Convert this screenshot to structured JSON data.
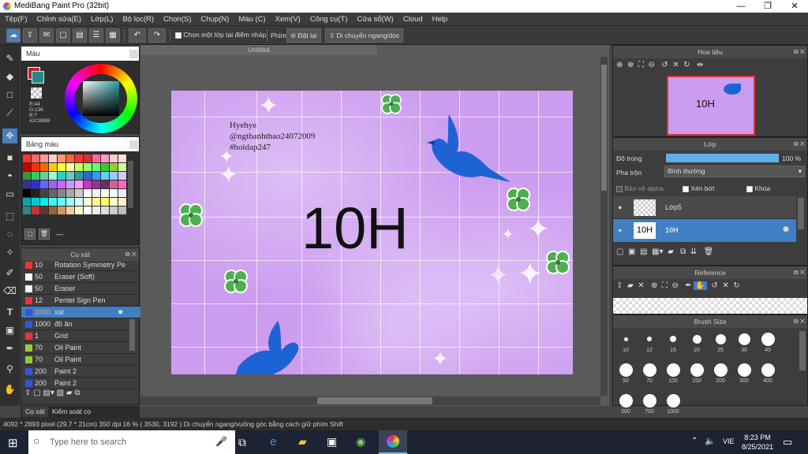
{
  "window": {
    "title": "MediBang Paint Pro (32bit)",
    "minimize_icon": "—",
    "restore_icon": "❐",
    "close_icon": "✕"
  },
  "menu": [
    "Tệp(F)",
    "Chỉnh sửa(E)",
    "Lớp(L)",
    "Bộ lọc(R)",
    "Chọn(S)",
    "Chụp(N)",
    "Màu (C)",
    "Xem(V)",
    "Công cụ(T)",
    "Cửa sổ(W)",
    "Cloud",
    "Help"
  ],
  "toolbar": {
    "sample_merged_label": "Chọn một lớp tại điểm nháp",
    "key_label": "Phím",
    "reset_label": "Đặt lại",
    "move_label": "Di chuyển ngang/dọc"
  },
  "color_panel": {
    "title": "Màu",
    "r": "R:44",
    "g": "G:136",
    "b": "B:?",
    "hex": "#2C8888"
  },
  "palette": {
    "title": "Bảng màu"
  },
  "document": {
    "tab_title": "Untitled"
  },
  "canvas": {
    "text_lines": [
      "Hyehye",
      "@ngthanhthao24072009",
      "#hoidap247"
    ],
    "big_text": "10H"
  },
  "navigator": {
    "title": "Hoa tiêu"
  },
  "layer_panel": {
    "title": "Lớp",
    "opacity_label": "Độ trong",
    "opacity_value": "100 %",
    "opacity_fraction": 1.0,
    "blend_label": "Pha trộn",
    "blend_value": "Bình thường",
    "protect_alpha": "Bảo vệ alpha",
    "clipping": "Xén bớt",
    "lock": "Khóa",
    "layers": [
      {
        "name": "Lớp5",
        "thumb": ""
      },
      {
        "name": "10H",
        "thumb": "10H"
      }
    ]
  },
  "reference": {
    "title": "Reference"
  },
  "brush_size": {
    "title": "Brush Size",
    "row1": [
      "10",
      "12",
      "15",
      "20",
      "25",
      "30",
      "40"
    ],
    "row2": [
      "50",
      "70",
      "100",
      "150",
      "200",
      "300",
      "400"
    ],
    "row3": [
      "500",
      "700",
      "1000"
    ]
  },
  "brush_panel": {
    "title": "Cọ xát",
    "brushes": [
      {
        "size": "10",
        "name": "Rotation Symmetry Pe",
        "color": "#e33"
      },
      {
        "size": "50",
        "name": "Eraser (Soft)",
        "color": "#fff"
      },
      {
        "size": "50",
        "name": "Eraser",
        "color": "#fff"
      },
      {
        "size": "12",
        "name": "Pentel  Sign Pen",
        "color": "#e33"
      },
      {
        "size": "1000",
        "name": "xát",
        "color": "#3355dd"
      },
      {
        "size": "1000",
        "name": "đồ ăn",
        "color": "#3355dd"
      },
      {
        "size": "1",
        "name": "Grid",
        "color": "#e33"
      },
      {
        "size": "70",
        "name": "Oil Paint",
        "color": "#9c3"
      },
      {
        "size": "70",
        "name": "Oil Paint",
        "color": "#9c3"
      },
      {
        "size": "200",
        "name": "Paint 2",
        "color": "#3355dd"
      },
      {
        "size": "200",
        "name": "Paint 2",
        "color": "#3355dd"
      }
    ],
    "tabs": [
      "Cọ xát",
      "Kiểm soát cọ"
    ]
  },
  "status": {
    "text": "4092 * 2893 pixel   (29.7 * 21cm)   350 dpi   16 %   ( 3530, 3192 )   Di chuyển ngang/vuông góc bằng cách giữ phím Shift"
  },
  "taskbar": {
    "search_placeholder": "Type here to search",
    "lang": "VIE",
    "time": "8:23 PM",
    "date": "8/25/2021"
  }
}
